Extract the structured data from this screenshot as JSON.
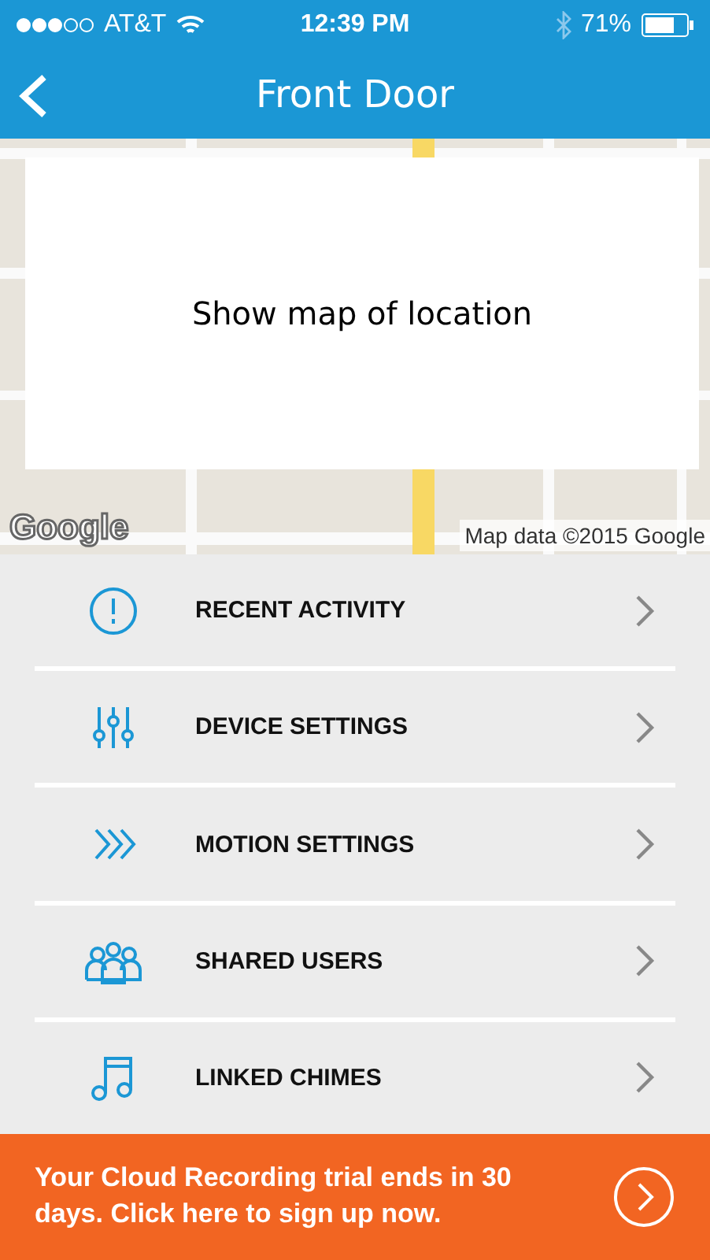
{
  "status_bar": {
    "carrier": "AT&T",
    "time": "12:39 PM",
    "battery": "71%"
  },
  "nav": {
    "title": "Front Door"
  },
  "map": {
    "overlay_text": "Show map of location",
    "logo": "Google",
    "attribution": "Map data ©2015 Google"
  },
  "menu": [
    {
      "kind": "alert",
      "label": "RECENT ACTIVITY"
    },
    {
      "kind": "sliders",
      "label": "DEVICE SETTINGS"
    },
    {
      "kind": "motion",
      "label": "MOTION SETTINGS"
    },
    {
      "kind": "users",
      "label": "SHARED USERS"
    },
    {
      "kind": "chimes",
      "label": "LINKED CHIMES"
    }
  ],
  "banner": {
    "text": "Your Cloud Recording trial ends in 30 days. Click here to sign up now."
  }
}
